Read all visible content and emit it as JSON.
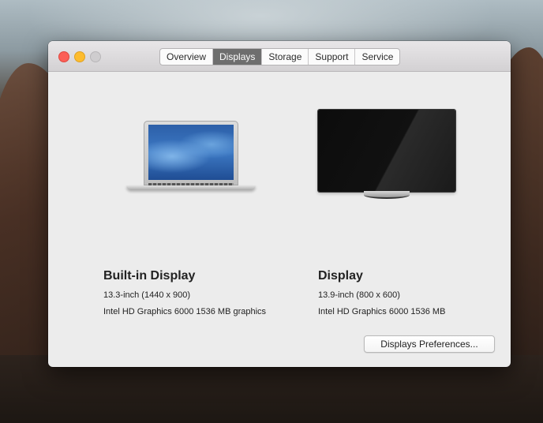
{
  "window": {
    "tabs": [
      {
        "label": "Overview"
      },
      {
        "label": "Displays"
      },
      {
        "label": "Storage"
      },
      {
        "label": "Support"
      },
      {
        "label": "Service"
      }
    ],
    "active_tab": "Displays"
  },
  "displays": [
    {
      "name": "Built-in Display",
      "size": "13.3-inch (1440 x 900)",
      "graphics": "Intel HD Graphics 6000 1536 MB graphics",
      "icon": "laptop-icon"
    },
    {
      "name": "Display",
      "size": "13.9-inch (800 x 600)",
      "graphics": "Intel HD Graphics 6000 1536 MB",
      "icon": "monitor-icon"
    }
  ],
  "footer": {
    "preferences_label": "Displays Preferences..."
  },
  "colors": {
    "close": "#fc5f57",
    "minimize": "#fdbc2e",
    "zoom": "#cfcdcf",
    "active_tab": "#6e6e6e"
  }
}
